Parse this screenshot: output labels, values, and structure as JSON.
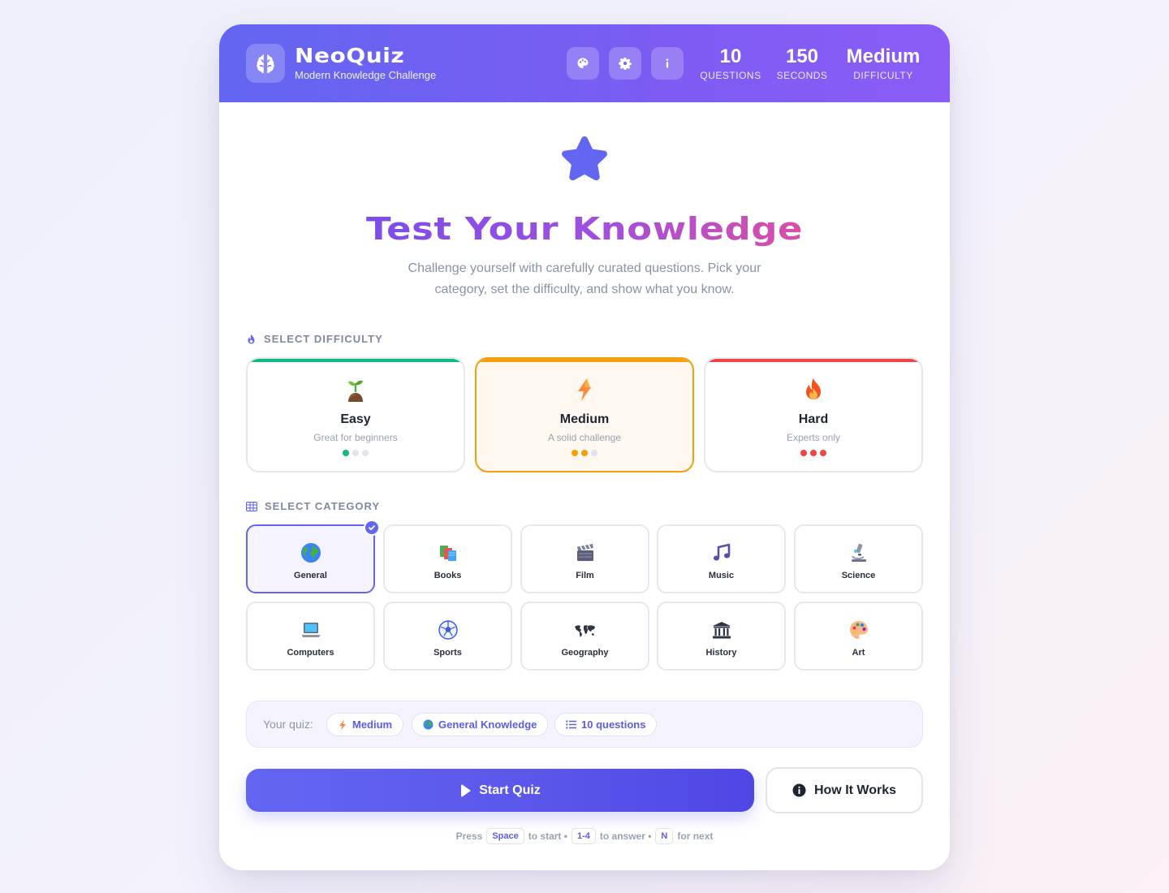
{
  "header": {
    "title": "NeoQuiz",
    "subtitle": "Modern Knowledge Challenge",
    "icons": [
      "brain-icon",
      "palette-icon",
      "gear-icon",
      "info-icon"
    ],
    "stats": [
      {
        "value": "10",
        "label": "QUESTIONS"
      },
      {
        "value": "150",
        "label": "SECONDS"
      },
      {
        "value": "Medium",
        "label": "DIFFICULTY"
      }
    ]
  },
  "hero": {
    "icon": "star-icon",
    "title": "Test Your Knowledge",
    "description": "Challenge yourself with carefully curated questions. Pick your category, set the difficulty, and show what you know."
  },
  "difficulty": {
    "label": "SELECT DIFFICULTY",
    "selected": "Medium",
    "options": [
      {
        "name": "Easy",
        "desc": "Great for beginners",
        "icon": "seedling-icon",
        "level": 1,
        "color": "#10b981"
      },
      {
        "name": "Medium",
        "desc": "A solid challenge",
        "icon": "lightning-icon",
        "level": 2,
        "color": "#f59e0b"
      },
      {
        "name": "Hard",
        "desc": "Experts only",
        "icon": "fire-icon",
        "level": 3,
        "color": "#ef4444"
      }
    ]
  },
  "category": {
    "label": "SELECT CATEGORY",
    "selected": "General",
    "items": [
      {
        "name": "General",
        "icon": "globe-icon"
      },
      {
        "name": "Books",
        "icon": "books-icon"
      },
      {
        "name": "Film",
        "icon": "clapperboard-icon"
      },
      {
        "name": "Music",
        "icon": "music-note-icon"
      },
      {
        "name": "Science",
        "icon": "microscope-icon"
      },
      {
        "name": "Computers",
        "icon": "laptop-icon"
      },
      {
        "name": "Sports",
        "icon": "soccer-ball-icon"
      },
      {
        "name": "Geography",
        "icon": "world-map-icon"
      },
      {
        "name": "History",
        "icon": "classical-building-icon"
      },
      {
        "name": "Art",
        "icon": "artist-palette-icon"
      }
    ]
  },
  "summary": {
    "label": "Your quiz:",
    "chips": [
      "Medium",
      "General Knowledge",
      "10 questions"
    ]
  },
  "actions": {
    "start": "Start Quiz",
    "how": "How It Works"
  },
  "shortcuts": {
    "press": "Press",
    "key_start": "Space",
    "to_start": "to start •",
    "key_answer": "1-4",
    "to_answer": "to answer •",
    "key_next": "N",
    "for_next": "for next"
  },
  "colors": {
    "accent": "#6366f1",
    "header_end": "#8b5cf6",
    "easy": "#10b981",
    "medium": "#f59e0b",
    "hard": "#ef4444"
  }
}
